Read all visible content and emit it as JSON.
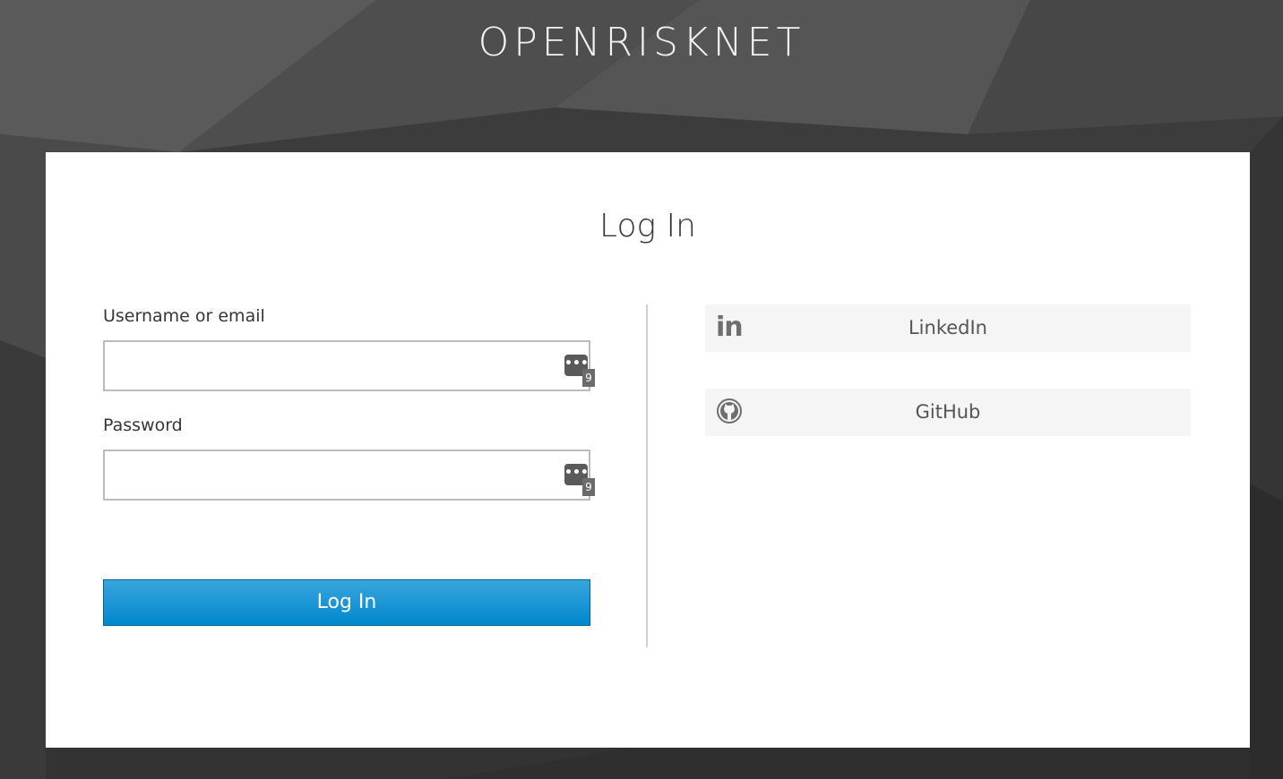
{
  "brand": {
    "title": "OPENRISKNET"
  },
  "login": {
    "title": "Log In",
    "username_label": "Username or email",
    "username_value": "",
    "password_label": "Password",
    "password_value": "",
    "password_manager_badge": "9",
    "submit_label": "Log In"
  },
  "social": {
    "providers": [
      {
        "label": "LinkedIn",
        "icon": "linkedin-icon",
        "icon_text": "in"
      },
      {
        "label": "GitHub",
        "icon": "github-icon"
      }
    ]
  },
  "colors": {
    "accent": "#0088ce",
    "background": "#3a3a3a",
    "card": "#ffffff"
  }
}
